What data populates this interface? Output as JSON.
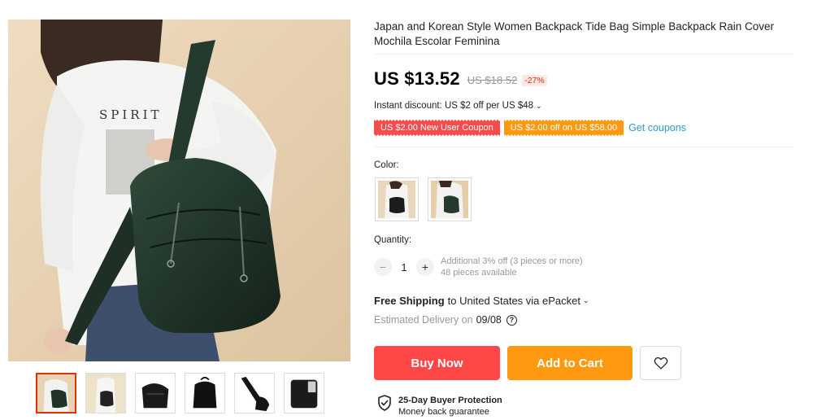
{
  "product": {
    "title": "Japan and Korean Style Women Backpack Tide Bag Simple Backpack Rain Cover Mochila Escolar Feminina",
    "price": "US $13.52",
    "old_price": "US $18.52",
    "discount": "-27%"
  },
  "promotions": {
    "instant_discount": "Instant discount: US $2 off per US $48",
    "coupons": [
      {
        "label": "US $2.00 New User Coupon",
        "color": "#f44b4b"
      },
      {
        "label": "US $2.00 off on US $58.00",
        "color": "#fb9a10"
      }
    ],
    "get_coupons_label": "Get coupons"
  },
  "variants": {
    "color_label": "Color:",
    "swatches": [
      "black-backpack-thumbnail",
      "green-backpack-thumbnail"
    ]
  },
  "quantity": {
    "label": "Quantity:",
    "value": "1",
    "minus": "−",
    "plus": "+",
    "bulk_offer": "Additional 3% off (3 pieces or more)",
    "available": "48 pieces available"
  },
  "shipping": {
    "free_label": "Free Shipping",
    "detail": "to United States via ePacket",
    "estimated_label": "Estimated Delivery on",
    "date": "09/08",
    "help_glyph": "?"
  },
  "actions": {
    "buy_now": "Buy Now",
    "add_to_cart": "Add to Cart",
    "wishlist_icon": "heart-icon"
  },
  "protection": {
    "title": "25-Day Buyer Protection",
    "subtitle": "Money back guarantee",
    "icon": "shield-check-icon"
  },
  "gallery": {
    "thumbnails": [
      "front-view",
      "model-view",
      "side-view",
      "back-view",
      "strap-view",
      "detail-view"
    ],
    "active_index": 0
  },
  "colors": {
    "accent_red": "#ff4747",
    "accent_orange": "#ff9a10",
    "link_blue": "#2e9cc3",
    "price_discount_red": "#e62e04"
  }
}
